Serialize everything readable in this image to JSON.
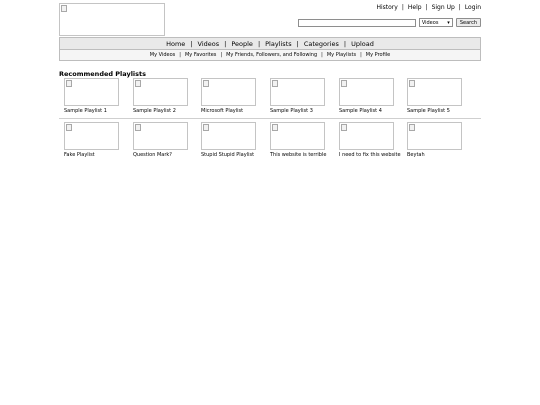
{
  "header": {
    "user_links": [
      "History",
      "Help",
      "Sign Up",
      "Login"
    ],
    "search": {
      "value": "",
      "placeholder": "",
      "scope": "Videos",
      "button": "Search"
    }
  },
  "main_nav": [
    "Home",
    "Videos",
    "People",
    "Playlists",
    "Categories",
    "Upload"
  ],
  "sub_nav": [
    "My Videos",
    "My Favorites",
    "My Friends, Followers, and Following",
    "My Playlists",
    "My Profile"
  ],
  "section": {
    "title": "Recommended Playlists"
  },
  "playlists": [
    {
      "title": "Sample Playlist 1"
    },
    {
      "title": "Sample Playlist 2"
    },
    {
      "title": "Microsoft Playlist"
    },
    {
      "title": "Sample Playlist 3"
    },
    {
      "title": "Sample Playlist 4"
    },
    {
      "title": "Sample Playlist 5"
    },
    {
      "title": "Fake Playlist"
    },
    {
      "title": "Question Mark?"
    },
    {
      "title": "Stupid Stupid Playlist"
    },
    {
      "title": "This website is terrible"
    },
    {
      "title": "I need to fix this website"
    },
    {
      "title": "Beytah"
    }
  ]
}
